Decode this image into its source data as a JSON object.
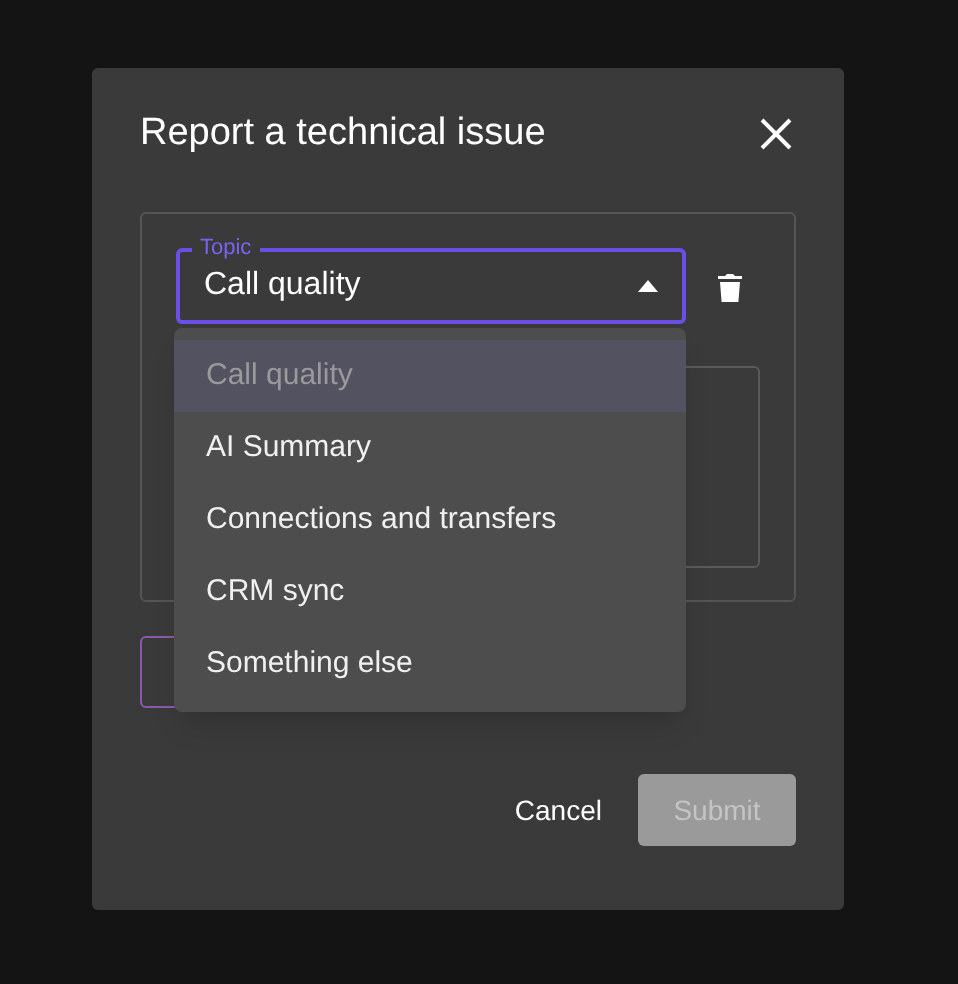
{
  "dialog": {
    "title": "Report a technical issue"
  },
  "topic": {
    "label": "Topic",
    "value": "Call quality",
    "expanded": true
  },
  "menu": [
    {
      "label": "Call quality",
      "selected": true
    },
    {
      "label": "AI Summary",
      "selected": false
    },
    {
      "label": "Connections and transfers",
      "selected": false
    },
    {
      "label": "CRM sync",
      "selected": false
    },
    {
      "label": "Something else",
      "selected": false
    }
  ],
  "buttons": [
    {
      "label": "Cancel",
      "kind": "text",
      "disabled": false
    },
    {
      "label": "Submit",
      "kind": "filled",
      "disabled": true
    }
  ]
}
